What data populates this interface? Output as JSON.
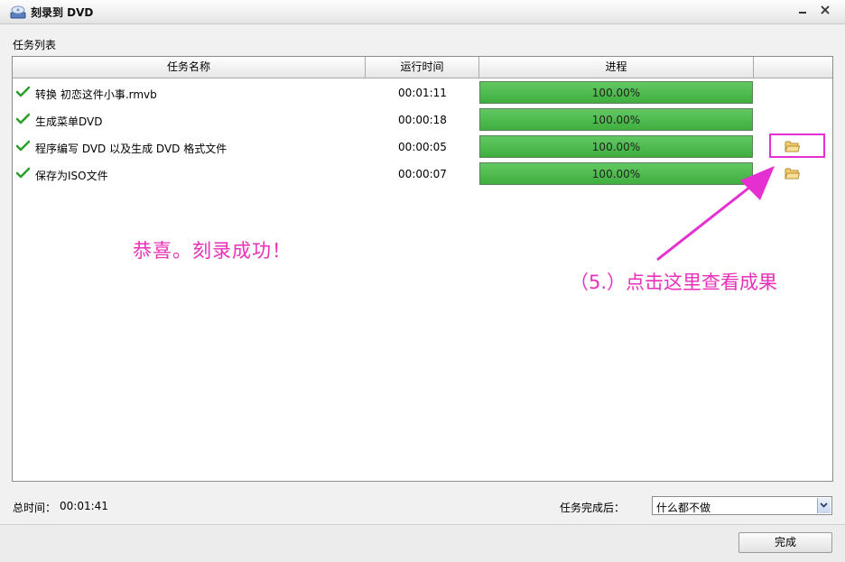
{
  "window": {
    "title": "刻录到 DVD",
    "minimize_icon": "minimize-icon",
    "close_icon": "close-icon"
  },
  "task_list": {
    "label": "任务列表",
    "columns": [
      "任务名称",
      "运行时间",
      "进程",
      ""
    ],
    "rows": [
      {
        "name": "转换 初恋这件小事.rmvb",
        "time": "00:01:11",
        "progress_text": "100.00%",
        "progress": 1.0,
        "status_icon": "check-icon",
        "has_folder": false
      },
      {
        "name": "生成菜单DVD",
        "time": "00:00:18",
        "progress_text": "100.00%",
        "progress": 1.0,
        "status_icon": "check-icon",
        "has_folder": false
      },
      {
        "name": "程序编写 DVD 以及生成 DVD 格式文件",
        "time": "00:00:05",
        "progress_text": "100.00%",
        "progress": 1.0,
        "status_icon": "check-icon",
        "has_folder": true
      },
      {
        "name": "保存为ISO文件",
        "time": "00:00:07",
        "progress_text": "100.00%",
        "progress": 1.0,
        "status_icon": "check-icon",
        "has_folder": true
      }
    ]
  },
  "annotations": {
    "success": "恭喜。刻录成功！",
    "step": "（5.）点击这里查看成果",
    "color": "#e830b9"
  },
  "footer": {
    "total_label": "总时间：",
    "total_value": "00:01:41",
    "after_label": "任务完成后：",
    "after_value": "什么都不做",
    "done_label": "完成"
  },
  "colors": {
    "progress": "#4cba4c",
    "highlight": "#e52fd1"
  }
}
